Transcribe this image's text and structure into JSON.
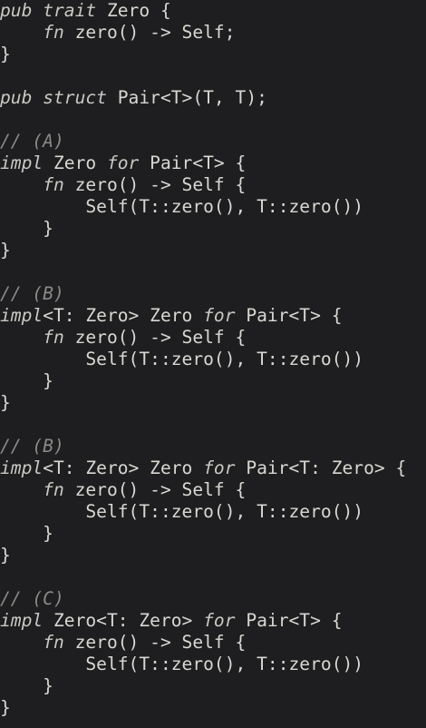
{
  "editor": {
    "language": "rust",
    "colors": {
      "background": "#1e1d1f",
      "text": "#d8d8d2",
      "keyword": "#c9c9c3",
      "comment": "#8a8a86"
    },
    "lines": [
      [
        {
          "t": "pub",
          "k": "kw"
        },
        {
          "t": " "
        },
        {
          "t": "trait",
          "k": "kw"
        },
        {
          "t": " Zero {"
        }
      ],
      [
        {
          "t": "    "
        },
        {
          "t": "fn",
          "k": "kw"
        },
        {
          "t": " zero() -> Self;"
        }
      ],
      [
        {
          "t": "}"
        }
      ],
      [],
      [
        {
          "t": "pub",
          "k": "kw"
        },
        {
          "t": " "
        },
        {
          "t": "struct",
          "k": "kw"
        },
        {
          "t": " Pair<T>(T, T);"
        }
      ],
      [],
      [
        {
          "t": "// (A)",
          "k": "cm"
        }
      ],
      [
        {
          "t": "impl",
          "k": "kw"
        },
        {
          "t": " Zero "
        },
        {
          "t": "for",
          "k": "kw"
        },
        {
          "t": " Pair<T> {"
        }
      ],
      [
        {
          "t": "    "
        },
        {
          "t": "fn",
          "k": "kw"
        },
        {
          "t": " zero() -> Self {"
        }
      ],
      [
        {
          "t": "        Self(T::zero(), T::zero())"
        }
      ],
      [
        {
          "t": "    }"
        }
      ],
      [
        {
          "t": "}"
        }
      ],
      [],
      [
        {
          "t": "// (B)",
          "k": "cm"
        }
      ],
      [
        {
          "t": "impl",
          "k": "kw"
        },
        {
          "t": "<T: Zero> Zero "
        },
        {
          "t": "for",
          "k": "kw"
        },
        {
          "t": " Pair<T> {"
        }
      ],
      [
        {
          "t": "    "
        },
        {
          "t": "fn",
          "k": "kw"
        },
        {
          "t": " zero() -> Self {"
        }
      ],
      [
        {
          "t": "        Self(T::zero(), T::zero())"
        }
      ],
      [
        {
          "t": "    }"
        }
      ],
      [
        {
          "t": "}"
        }
      ],
      [],
      [
        {
          "t": "// (B)",
          "k": "cm"
        }
      ],
      [
        {
          "t": "impl",
          "k": "kw"
        },
        {
          "t": "<T: Zero> Zero "
        },
        {
          "t": "for",
          "k": "kw"
        },
        {
          "t": " Pair<T: Zero> {"
        }
      ],
      [
        {
          "t": "    "
        },
        {
          "t": "fn",
          "k": "kw"
        },
        {
          "t": " zero() -> Self {"
        }
      ],
      [
        {
          "t": "        Self(T::zero(), T::zero())"
        }
      ],
      [
        {
          "t": "    }"
        }
      ],
      [
        {
          "t": "}"
        }
      ],
      [],
      [
        {
          "t": "// (C)",
          "k": "cm"
        }
      ],
      [
        {
          "t": "impl",
          "k": "kw"
        },
        {
          "t": " Zero<T: Zero> "
        },
        {
          "t": "for",
          "k": "kw"
        },
        {
          "t": " Pair<T> {"
        }
      ],
      [
        {
          "t": "    "
        },
        {
          "t": "fn",
          "k": "kw"
        },
        {
          "t": " zero() -> Self {"
        }
      ],
      [
        {
          "t": "        Self(T::zero(), T::zero())"
        }
      ],
      [
        {
          "t": "    }"
        }
      ],
      [
        {
          "t": "}"
        }
      ]
    ]
  }
}
